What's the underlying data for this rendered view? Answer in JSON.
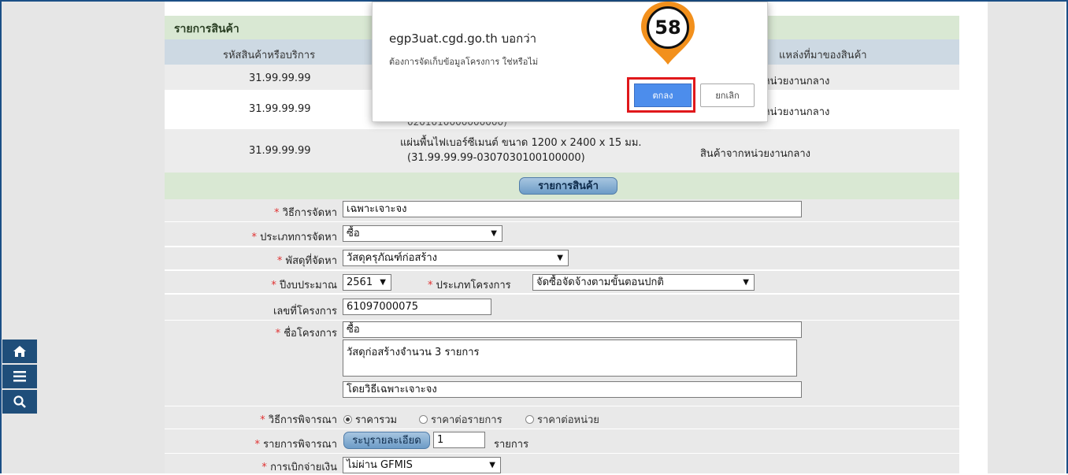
{
  "products_section": {
    "title": "รายการสินค้า",
    "columns": [
      "รหัสสินค้าหรือบริการ",
      "แหล่งที่มาของสินค้า"
    ],
    "rows": [
      {
        "code": "31.99.99.99",
        "name": "",
        "source": "หน่วยงานกลาง"
      },
      {
        "code": "31.99.99.99",
        "name": "0201010000000000)",
        "source": "หน่วยงานกลาง"
      },
      {
        "code": "31.99.99.99",
        "name_line1": "แผ่นพื้นไฟเบอร์ซีเมนต์ ขนาด 1200 x 2400 x 15 มม.",
        "name_line2": "(31.99.99.99-0307030100100000)",
        "source": "สินค้าจากหน่วยงานกลาง"
      }
    ],
    "button_label": "รายการสินค้า"
  },
  "form": {
    "method": {
      "label": "วิธีการจัดหา",
      "value": "เฉพาะเจาะจง"
    },
    "procurement_type": {
      "label": "ประเภทการจัดหา",
      "value": "ซื้อ"
    },
    "supply": {
      "label": "พัสดุที่จัดหา",
      "value": "วัสดุครุภัณฑ์ก่อสร้าง"
    },
    "budget_year": {
      "label": "ปีงบประมาณ",
      "value": "2561"
    },
    "project_type": {
      "label": "ประเภทโครงการ",
      "value": "จัดซื้อจัดจ้างตามขั้นตอนปกติ"
    },
    "project_no": {
      "label": "เลขที่โครงการ",
      "value": "61097000075"
    },
    "project_name": {
      "label": "ชื่อโครงการ",
      "line1": "ซื้อ",
      "line2": "วัสดุก่อสร้างจำนวน 3 รายการ",
      "line3": "โดยวิธีเฉพาะเจาะจง"
    },
    "consideration": {
      "label": "วิธีการพิจารณา",
      "options": [
        "ราคารวม",
        "ราคาต่อรายการ",
        "ราคาต่อหน่วย"
      ],
      "selected": "ราคารวม"
    },
    "consideration_items": {
      "label": "รายการพิจารณา",
      "button": "ระบุรายละเอียด",
      "count": "1",
      "unit": "รายการ"
    },
    "disbursement": {
      "label": "การเบิกจ่ายเงิน",
      "value": "ไม่ผ่าน GFMIS"
    },
    "required_mark": "*"
  },
  "side_toolbar": {
    "icons": [
      "home-icon",
      "menu-icon",
      "search-icon"
    ]
  },
  "dialog": {
    "origin": "egp3uat.cgd.go.th บอกว่า",
    "message": "ต้องการจัดเก็บข้อมูลโครงการ ใช่หรือไม่",
    "ok_label": "ตกลง",
    "cancel_label": "ยกเลิก"
  },
  "annotation": {
    "step_number": "58",
    "marker_color": "#f2901c",
    "highlight_color": "#e0181b"
  }
}
